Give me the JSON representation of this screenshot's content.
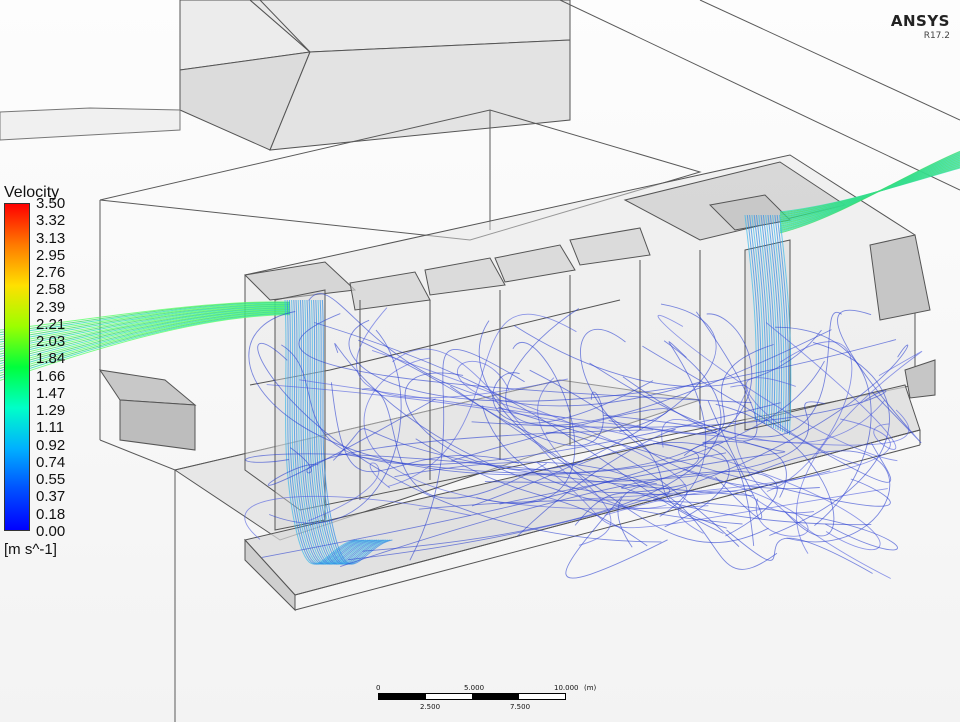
{
  "viewer": {
    "logo": {
      "brand": "ANSYS",
      "version": "R17.2",
      "icon": "ansys-logo"
    }
  },
  "legend": {
    "title": "Velocity",
    "units": "[m s^-1]",
    "ticks": [
      "3.50",
      "3.32",
      "3.13",
      "2.95",
      "2.76",
      "2.58",
      "2.39",
      "2.21",
      "2.03",
      "1.84",
      "1.66",
      "1.47",
      "1.29",
      "1.11",
      "0.92",
      "0.74",
      "0.55",
      "0.37",
      "0.18",
      "0.00"
    ],
    "colormap": [
      "#ff0000",
      "#ff7a00",
      "#ffe000",
      "#9cff00",
      "#00ff3c",
      "#00ffc8",
      "#00b0ff",
      "#0050ff",
      "#0000ff"
    ]
  },
  "scale_bar": {
    "top_labels": [
      "0",
      "5.000",
      "10.000"
    ],
    "unit": "(m)",
    "bottom_labels": [
      "2.500",
      "7.500"
    ]
  },
  "streamlines": {
    "outside_color": "#3ddc6a",
    "inlet_color": "#2f8fe6",
    "interior_color": "#2a3fd1"
  }
}
